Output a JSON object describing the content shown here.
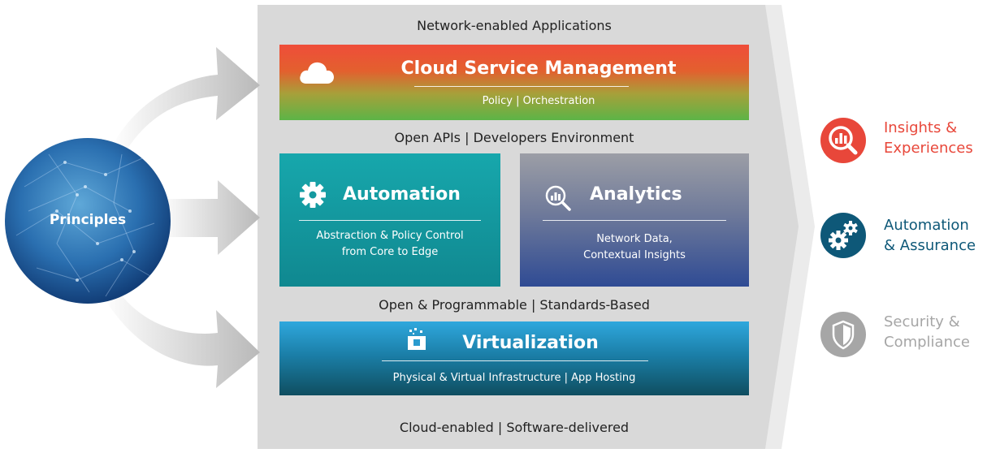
{
  "top_label": "Network-enabled Applications",
  "apis_label": "Open APIs | Developers Environment",
  "programmable_label": "Open & Programmable  | Standards-Based",
  "bottom_label": "Cloud-enabled | Software-delivered",
  "principles": {
    "label": "Principles"
  },
  "cloud": {
    "title": "Cloud Service Management",
    "subtitle": "Policy | Orchestration",
    "icon": "cloud-icon"
  },
  "automation": {
    "title": "Automation",
    "line1": "Abstraction & Policy Control",
    "line2": "from Core to Edge",
    "icon": "gear-icon"
  },
  "analytics": {
    "title": "Analytics",
    "line1": "Network Data,",
    "line2": "Contextual Insights",
    "icon": "magnifier-chart-icon"
  },
  "virtualization": {
    "title": "Virtualization",
    "subtitle": "Physical & Virtual Infrastructure | App Hosting",
    "icon": "virtual-cube-icon"
  },
  "outcomes": [
    {
      "line1": "Insights &",
      "line2": "Experiences",
      "color": "#e8473a",
      "icon": "insight-magnifier-icon"
    },
    {
      "line1": "Automation",
      "line2": "& Assurance",
      "color": "#0e5878",
      "icon": "gears-icon"
    },
    {
      "line1": "Security &",
      "line2": "Compliance",
      "color": "#a6a6a6",
      "icon": "shield-icon"
    }
  ]
}
